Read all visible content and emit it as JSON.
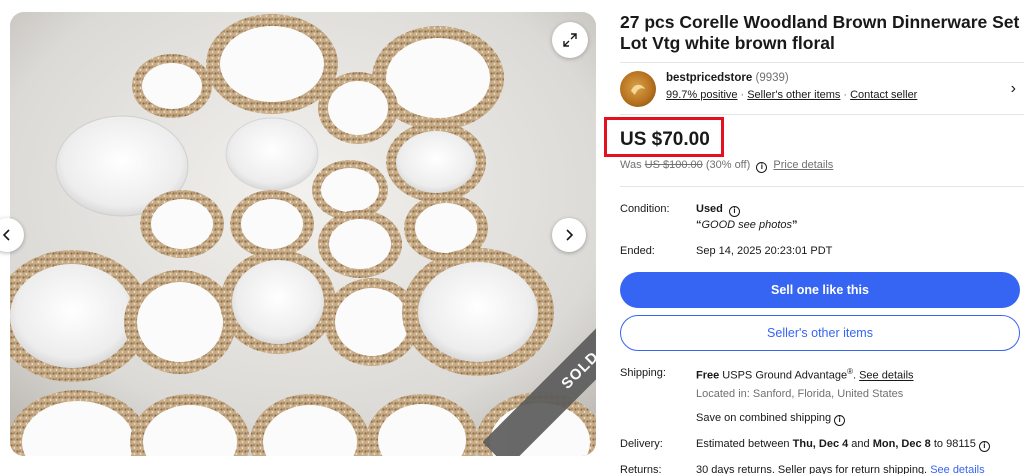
{
  "listing": {
    "title": "27 pcs Corelle Woodland Brown Dinnerware Set Lot Vtg white brown floral",
    "image_overlay": "SOLD"
  },
  "gallery": {
    "expand_icon": "expand-icon",
    "prev_icon": "chevron-left-icon",
    "next_icon": "chevron-right-icon",
    "prev_glyph": "‹",
    "next_glyph": "›"
  },
  "seller": {
    "name": "bestpricedstore",
    "feedback_count": "(9939)",
    "positive": "99.7% positive",
    "separator": "·",
    "other_items": "Seller's other items",
    "contact": "Contact seller",
    "chevron_glyph": "›"
  },
  "price": {
    "current": "US $70.00",
    "was_label": "Was",
    "was_value": "US $100.00",
    "discount": "(30% off)",
    "details_link": "Price details",
    "highlight_color": "#e3101d"
  },
  "condition": {
    "label": "Condition:",
    "value": "Used",
    "note_open": "“",
    "note": "GOOD see photos",
    "note_close": "”"
  },
  "ended": {
    "label": "Ended:",
    "value": "Sep 14, 2025 20:23:01 PDT"
  },
  "buttons": {
    "sell_one": "Sell one like this",
    "other_items": "Seller's other items",
    "primary_color": "#3665f3"
  },
  "shipping": {
    "label": "Shipping:",
    "free": "Free",
    "service": " USPS Ground Advantage",
    "reg": "®",
    "comma": ".",
    "details": "See details",
    "location": "Located in: Sanford, Florida, United States",
    "combined": "Save on combined shipping"
  },
  "delivery": {
    "label": "Delivery:",
    "prefix": "Estimated between ",
    "start": "Thu, Dec 4",
    "and": " and ",
    "end": "Mon, Dec 8",
    "to": " to 98115"
  },
  "returns": {
    "label": "Returns:",
    "text": "30 days returns. Seller pays for return shipping. ",
    "details": "See details"
  }
}
